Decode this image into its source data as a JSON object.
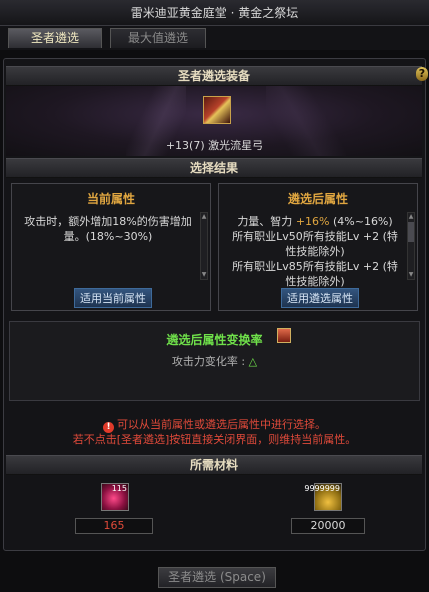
{
  "window": {
    "title": "雷米迪亚黄金庭堂 · 黄金之祭坛"
  },
  "tabs": [
    {
      "label": "圣者遴选",
      "active": true
    },
    {
      "label": "最大值遴选",
      "active": false
    }
  ],
  "equipment": {
    "section_title": "圣者遴选装备",
    "help": "?",
    "item_name": "+13(7) 激光流星弓"
  },
  "results": {
    "section_title": "选择结果",
    "current": {
      "title": "当前属性",
      "lines": [
        "攻击时，额外增加18%的伤害增加量。(18%~30%)"
      ],
      "button": "适用当前属性"
    },
    "after": {
      "title": "遴选后属性",
      "line1_prefix": "力量、智力 ",
      "line1_value": "+16%",
      "line1_range": " (4%~16%)",
      "line2": "所有职业Lv50所有技能Lv +2 (特性技能除外)",
      "line3": "所有职业Lv85所有技能Lv +2 (特性技能除外)",
      "button": "适用遴选属性"
    }
  },
  "conversion": {
    "title": "遴选后属性变换率",
    "line_label": "攻击力变化率 : ",
    "line_symbol": "△"
  },
  "notes": [
    "可以从当前属性或遴选后属性中进行选择。",
    "若不点击[圣者遴选]按钮直接关闭界面，则维持当前属性。"
  ],
  "materials": {
    "section_title": "所需材料",
    "items": [
      {
        "icon": "pink-orb-icon",
        "badge": "115",
        "value": "165",
        "value_color": "#e04a3a"
      },
      {
        "icon": "gold-coins-icon",
        "badge": "9999999",
        "value": "20000",
        "value_color": "#d8d8d8"
      }
    ]
  },
  "footer": {
    "button": "圣者遴选 (Space)"
  }
}
